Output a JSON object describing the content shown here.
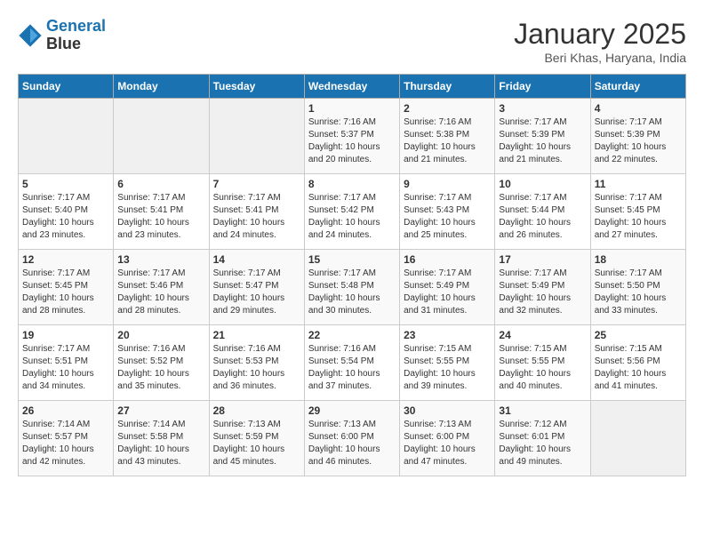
{
  "header": {
    "logo_line1": "General",
    "logo_line2": "Blue",
    "title": "January 2025",
    "subtitle": "Beri Khas, Haryana, India"
  },
  "weekdays": [
    "Sunday",
    "Monday",
    "Tuesday",
    "Wednesday",
    "Thursday",
    "Friday",
    "Saturday"
  ],
  "weeks": [
    [
      {
        "day": "",
        "info": ""
      },
      {
        "day": "",
        "info": ""
      },
      {
        "day": "",
        "info": ""
      },
      {
        "day": "1",
        "info": "Sunrise: 7:16 AM\nSunset: 5:37 PM\nDaylight: 10 hours\nand 20 minutes."
      },
      {
        "day": "2",
        "info": "Sunrise: 7:16 AM\nSunset: 5:38 PM\nDaylight: 10 hours\nand 21 minutes."
      },
      {
        "day": "3",
        "info": "Sunrise: 7:17 AM\nSunset: 5:39 PM\nDaylight: 10 hours\nand 21 minutes."
      },
      {
        "day": "4",
        "info": "Sunrise: 7:17 AM\nSunset: 5:39 PM\nDaylight: 10 hours\nand 22 minutes."
      }
    ],
    [
      {
        "day": "5",
        "info": "Sunrise: 7:17 AM\nSunset: 5:40 PM\nDaylight: 10 hours\nand 23 minutes."
      },
      {
        "day": "6",
        "info": "Sunrise: 7:17 AM\nSunset: 5:41 PM\nDaylight: 10 hours\nand 23 minutes."
      },
      {
        "day": "7",
        "info": "Sunrise: 7:17 AM\nSunset: 5:41 PM\nDaylight: 10 hours\nand 24 minutes."
      },
      {
        "day": "8",
        "info": "Sunrise: 7:17 AM\nSunset: 5:42 PM\nDaylight: 10 hours\nand 24 minutes."
      },
      {
        "day": "9",
        "info": "Sunrise: 7:17 AM\nSunset: 5:43 PM\nDaylight: 10 hours\nand 25 minutes."
      },
      {
        "day": "10",
        "info": "Sunrise: 7:17 AM\nSunset: 5:44 PM\nDaylight: 10 hours\nand 26 minutes."
      },
      {
        "day": "11",
        "info": "Sunrise: 7:17 AM\nSunset: 5:45 PM\nDaylight: 10 hours\nand 27 minutes."
      }
    ],
    [
      {
        "day": "12",
        "info": "Sunrise: 7:17 AM\nSunset: 5:45 PM\nDaylight: 10 hours\nand 28 minutes."
      },
      {
        "day": "13",
        "info": "Sunrise: 7:17 AM\nSunset: 5:46 PM\nDaylight: 10 hours\nand 28 minutes."
      },
      {
        "day": "14",
        "info": "Sunrise: 7:17 AM\nSunset: 5:47 PM\nDaylight: 10 hours\nand 29 minutes."
      },
      {
        "day": "15",
        "info": "Sunrise: 7:17 AM\nSunset: 5:48 PM\nDaylight: 10 hours\nand 30 minutes."
      },
      {
        "day": "16",
        "info": "Sunrise: 7:17 AM\nSunset: 5:49 PM\nDaylight: 10 hours\nand 31 minutes."
      },
      {
        "day": "17",
        "info": "Sunrise: 7:17 AM\nSunset: 5:49 PM\nDaylight: 10 hours\nand 32 minutes."
      },
      {
        "day": "18",
        "info": "Sunrise: 7:17 AM\nSunset: 5:50 PM\nDaylight: 10 hours\nand 33 minutes."
      }
    ],
    [
      {
        "day": "19",
        "info": "Sunrise: 7:17 AM\nSunset: 5:51 PM\nDaylight: 10 hours\nand 34 minutes."
      },
      {
        "day": "20",
        "info": "Sunrise: 7:16 AM\nSunset: 5:52 PM\nDaylight: 10 hours\nand 35 minutes."
      },
      {
        "day": "21",
        "info": "Sunrise: 7:16 AM\nSunset: 5:53 PM\nDaylight: 10 hours\nand 36 minutes."
      },
      {
        "day": "22",
        "info": "Sunrise: 7:16 AM\nSunset: 5:54 PM\nDaylight: 10 hours\nand 37 minutes."
      },
      {
        "day": "23",
        "info": "Sunrise: 7:15 AM\nSunset: 5:55 PM\nDaylight: 10 hours\nand 39 minutes."
      },
      {
        "day": "24",
        "info": "Sunrise: 7:15 AM\nSunset: 5:55 PM\nDaylight: 10 hours\nand 40 minutes."
      },
      {
        "day": "25",
        "info": "Sunrise: 7:15 AM\nSunset: 5:56 PM\nDaylight: 10 hours\nand 41 minutes."
      }
    ],
    [
      {
        "day": "26",
        "info": "Sunrise: 7:14 AM\nSunset: 5:57 PM\nDaylight: 10 hours\nand 42 minutes."
      },
      {
        "day": "27",
        "info": "Sunrise: 7:14 AM\nSunset: 5:58 PM\nDaylight: 10 hours\nand 43 minutes."
      },
      {
        "day": "28",
        "info": "Sunrise: 7:13 AM\nSunset: 5:59 PM\nDaylight: 10 hours\nand 45 minutes."
      },
      {
        "day": "29",
        "info": "Sunrise: 7:13 AM\nSunset: 6:00 PM\nDaylight: 10 hours\nand 46 minutes."
      },
      {
        "day": "30",
        "info": "Sunrise: 7:13 AM\nSunset: 6:00 PM\nDaylight: 10 hours\nand 47 minutes."
      },
      {
        "day": "31",
        "info": "Sunrise: 7:12 AM\nSunset: 6:01 PM\nDaylight: 10 hours\nand 49 minutes."
      },
      {
        "day": "",
        "info": ""
      }
    ]
  ]
}
